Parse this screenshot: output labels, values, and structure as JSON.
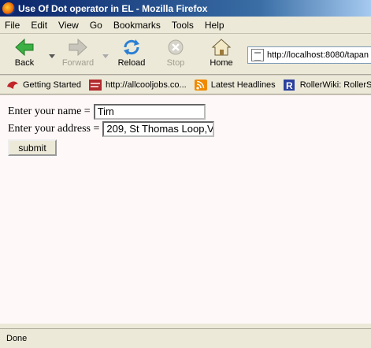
{
  "window": {
    "title": "Use Of Dot operator in EL - Mozilla Firefox"
  },
  "menu": [
    "File",
    "Edit",
    "View",
    "Go",
    "Bookmarks",
    "Tools",
    "Help"
  ],
  "nav": {
    "back": "Back",
    "forward": "Forward",
    "reload": "Reload",
    "stop": "Stop",
    "home": "Home"
  },
  "address": {
    "url": "http://localhost:8080/tapan"
  },
  "bookmarks": [
    {
      "label": "Getting Started",
      "icon": "getting-started-icon"
    },
    {
      "label": "http://allcooljobs.co...",
      "icon": "allcooljobs-icon"
    },
    {
      "label": "Latest Headlines",
      "icon": "rss-icon"
    },
    {
      "label": "RollerWiki: RollerS",
      "icon": "rollerwiki-icon"
    }
  ],
  "form": {
    "name_label": "Enter your name =",
    "name_value": "Tim",
    "address_label": "Enter your address =",
    "address_value": "209, St Thomas Loop,V",
    "submit_label": "submit"
  },
  "status": {
    "text": "Done"
  }
}
